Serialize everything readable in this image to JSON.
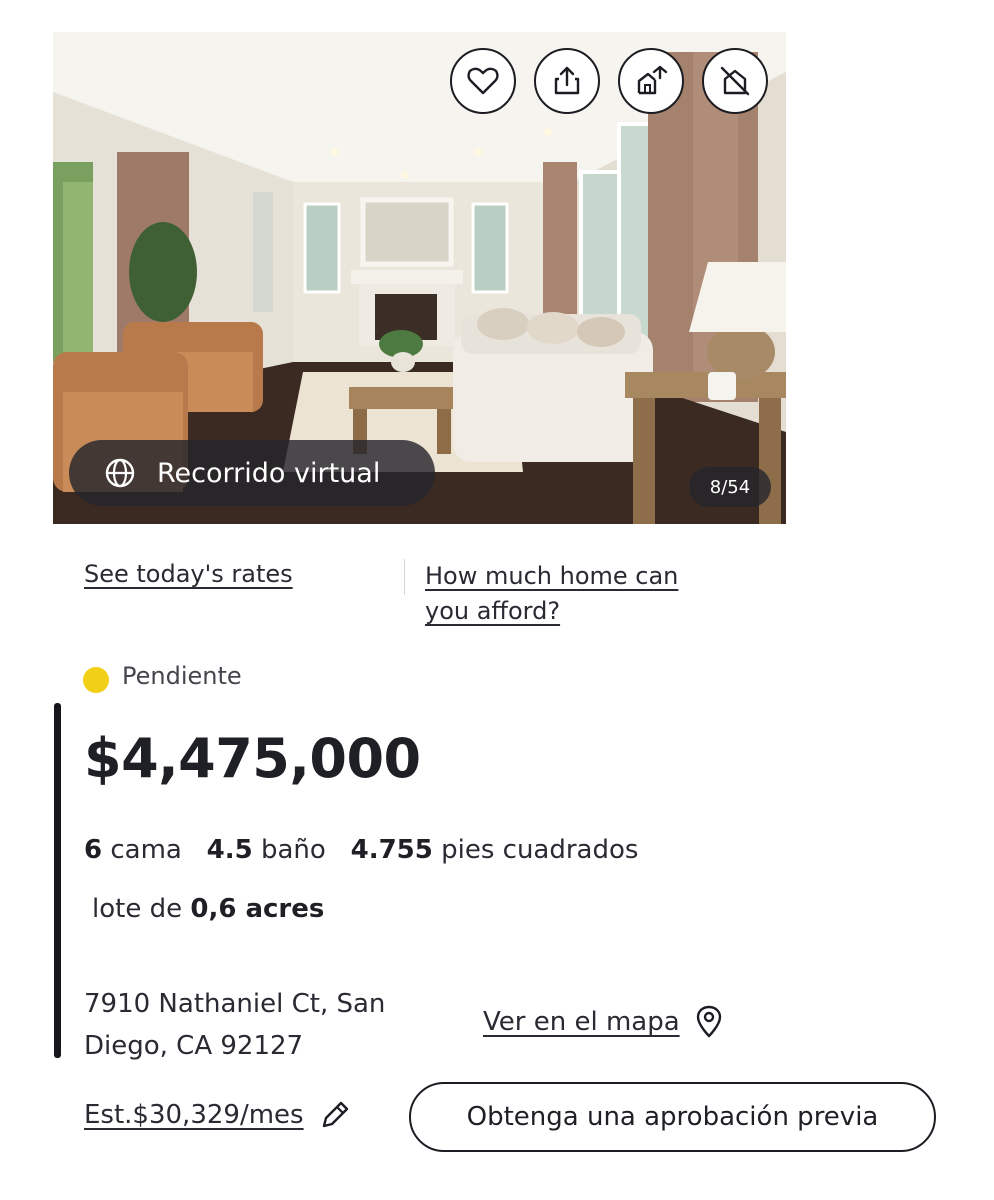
{
  "photo": {
    "virtual_tour_label": "Recorrido virtual",
    "counter": "8/54",
    "action_icons": [
      "heart-icon",
      "share-icon",
      "home-swap-icon",
      "hide-icon"
    ]
  },
  "links": {
    "rates": "See today's rates",
    "afford_line1": "How much home can",
    "afford_line2": "you afford?"
  },
  "status": {
    "label": "Pendiente",
    "color": "#f2cf17"
  },
  "price": "$4,475,000",
  "facts": {
    "beds_value": "6",
    "beds_label": "cama",
    "baths_value": "4.5",
    "baths_label": "baño",
    "sqft_value": "4.755",
    "sqft_label": "pies cuadrados",
    "lot_prefix": "lote de",
    "lot_value": "0,6 acres"
  },
  "address": {
    "line1": "7910 Nathaniel Ct, San",
    "line2": "Diego, CA 92127"
  },
  "map_link": "Ver en el mapa",
  "estimate": "Est.$30,329/mes",
  "preapproval_button": "Obtenga una aprobación previa"
}
